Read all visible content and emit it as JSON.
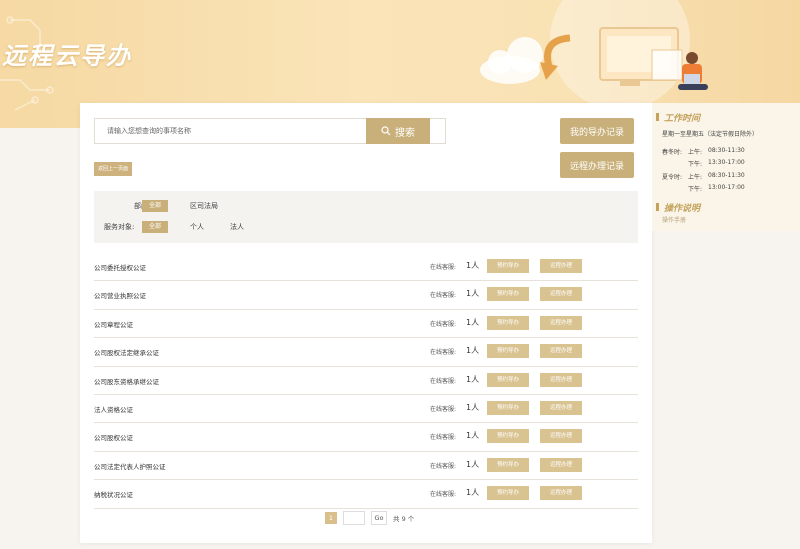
{
  "banner": {
    "title": "远程云导办"
  },
  "search": {
    "placeholder": "请输入您想查询的事项名称",
    "button_label": "搜索"
  },
  "side_buttons": {
    "my_records": "我的导办记录",
    "remote_records": "远程办理记录"
  },
  "back_label": "返回上一页面",
  "filters": {
    "dept_label": "部门:",
    "dept_options": [
      "全部",
      "区司法局"
    ],
    "target_label": "服务对象:",
    "target_options": [
      "全部",
      "个人",
      "法人"
    ]
  },
  "rows": [
    {
      "name": "公司委托授权公证",
      "online_label": "在线客服:",
      "count": "1人",
      "guide": "预约导办",
      "apply": "远程办理"
    },
    {
      "name": "公司营业执照公证",
      "online_label": "在线客服:",
      "count": "1人",
      "guide": "预约导办",
      "apply": "远程办理"
    },
    {
      "name": "公司章程公证",
      "online_label": "在线客服:",
      "count": "1人",
      "guide": "预约导办",
      "apply": "远程办理"
    },
    {
      "name": "公司股权法定继承公证",
      "online_label": "在线客服:",
      "count": "1人",
      "guide": "预约导办",
      "apply": "远程办理"
    },
    {
      "name": "公司股东资格承继公证",
      "online_label": "在线客服:",
      "count": "1人",
      "guide": "预约导办",
      "apply": "远程办理"
    },
    {
      "name": "法人资格公证",
      "online_label": "在线客服:",
      "count": "1人",
      "guide": "预约导办",
      "apply": "远程办理"
    },
    {
      "name": "公司股权公证",
      "online_label": "在线客服:",
      "count": "1人",
      "guide": "预约导办",
      "apply": "远程办理"
    },
    {
      "name": "公司法定代表人护照公证",
      "online_label": "在线客服:",
      "count": "1人",
      "guide": "预约导办",
      "apply": "远程办理"
    },
    {
      "name": "纳税状况公证",
      "online_label": "在线客服:",
      "count": "1人",
      "guide": "预约导办",
      "apply": "远程办理"
    }
  ],
  "pagination": {
    "current": "1",
    "go": "Go",
    "total": "共 9 个"
  },
  "side_panel": {
    "work_time_title": "工作时间",
    "days": "星期一至星期五（法定节假日除外）",
    "spring_label": "春冬时:",
    "summer_label": "夏令时:",
    "am_label": "上午:",
    "pm_label": "下午:",
    "spring_am": "08:30-11:30",
    "spring_pm": "13:30-17:00",
    "summer_am": "08:30-11:30",
    "summer_pm": "13:00-17:00",
    "guide_title": "操作说明",
    "guide_link": "操作手册"
  },
  "colors": {
    "accent": "#c9b07a",
    "banner": "#f6d9a3"
  }
}
